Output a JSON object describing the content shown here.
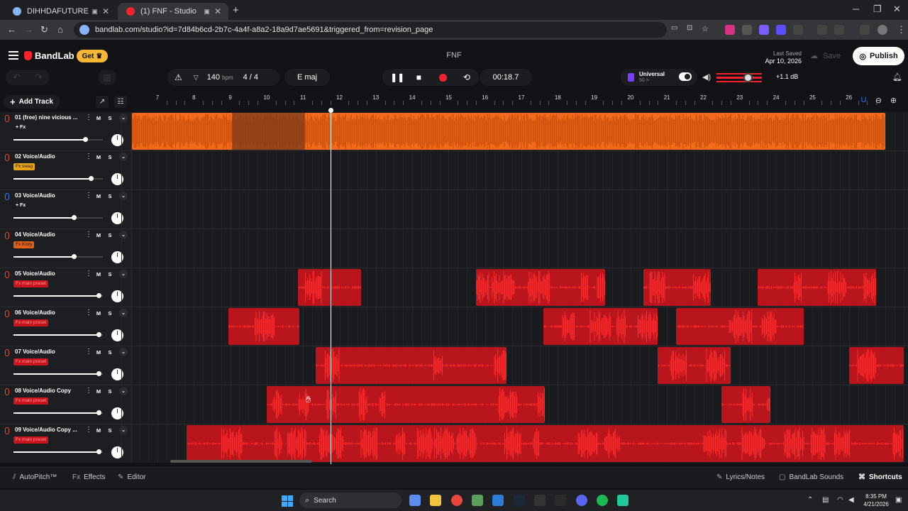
{
  "browser": {
    "tabs": [
      {
        "label": "DIHHDAFUTURE",
        "active": false
      },
      {
        "label": "(1) FNF - Studio",
        "active": true
      }
    ],
    "url": "bandlab.com/studio?id=7d84b6cd-2b7c-4a4f-a8a2-18a9d7ae5691&triggered_from=revision_page"
  },
  "app": {
    "logo": "BandLab",
    "get_label": "Get",
    "project_title": "FNF",
    "last_saved_label": "Last Saved",
    "last_saved_date": "Apr 10, 2026",
    "save_label": "Save",
    "publish_label": "Publish"
  },
  "toolbar": {
    "bpm": "140",
    "bpm_unit": "bpm",
    "time_signature": "4 / 4",
    "key": "E maj",
    "time": "00:18.7",
    "universal_title": "Universal",
    "universal_sub": "50 >",
    "volume_db": "+1.1 dB",
    "volume_level": 0.68
  },
  "sidebar": {
    "add_track_label": "Add Track"
  },
  "ruler": {
    "bars": [
      "7",
      "8",
      "9",
      "10",
      "11",
      "12",
      "13",
      "14",
      "15",
      "16",
      "17",
      "18",
      "19",
      "20",
      "21",
      "22",
      "23",
      "24",
      "25",
      "26"
    ]
  },
  "playhead_bar": 11.75,
  "tracks": [
    {
      "name": "01  (free) nine vicious ...",
      "fx": "+ Fx",
      "fx_style": "plain",
      "volume": 0.78,
      "color": "orange",
      "clips": [
        {
          "start": 6.25,
          "end": 27.0,
          "color": "orange",
          "muted_segment": [
            9.05,
            11.05
          ]
        }
      ]
    },
    {
      "name": "02  Voice/Audio",
      "fx": "Fx swag",
      "fx_style": "yellow",
      "volume": 0.84,
      "color": "red",
      "clips": []
    },
    {
      "name": "03  Voice/Audio",
      "fx": "+ Fx",
      "fx_style": "plain",
      "volume": 0.65,
      "color": "blue",
      "clips": []
    },
    {
      "name": "04  Voice/Audio",
      "fx": "Fx Kozy",
      "fx_style": "orange",
      "volume": 0.65,
      "color": "red",
      "clips": []
    },
    {
      "name": "05  Voice/Audio",
      "fx": "Fx main preset",
      "fx_style": "red",
      "volume": 0.92,
      "color": "red",
      "clips": [
        {
          "start": 10.85,
          "end": 12.6
        },
        {
          "start": 15.75,
          "end": 19.3
        },
        {
          "start": 20.35,
          "end": 22.2
        },
        {
          "start": 23.5,
          "end": 26.75
        }
      ]
    },
    {
      "name": "06  Voice/Audio",
      "fx": "Fx main preset",
      "fx_style": "red",
      "volume": 0.92,
      "color": "red",
      "clips": [
        {
          "start": 8.95,
          "end": 10.9
        },
        {
          "start": 17.6,
          "end": 20.75
        },
        {
          "start": 21.25,
          "end": 24.75
        }
      ]
    },
    {
      "name": "07  Voice/Audio",
      "fx": "Fx main preset",
      "fx_style": "red",
      "volume": 0.92,
      "color": "red",
      "clips": [
        {
          "start": 11.35,
          "end": 16.6
        },
        {
          "start": 20.75,
          "end": 22.75
        },
        {
          "start": 26.0,
          "end": 27.5
        }
      ]
    },
    {
      "name": "08  Voice/Audio Copy",
      "fx": "Fx main preset",
      "fx_style": "red",
      "volume": 0.92,
      "color": "red",
      "clips": [
        {
          "start": 10.0,
          "end": 17.65
        },
        {
          "start": 22.5,
          "end": 23.85
        }
      ]
    },
    {
      "name": "09  Voice/Audio Copy ...",
      "fx": "Fx main preset",
      "fx_style": "red",
      "volume": 0.92,
      "color": "red",
      "clips": [
        {
          "start": 7.8,
          "end": 27.5
        }
      ]
    }
  ],
  "bottom": {
    "autopitch": "AutoPitch™",
    "effects": "Effects",
    "editor": "Editor",
    "lyrics": "Lyrics/Notes",
    "sounds": "BandLab Sounds",
    "shortcuts": "Shortcuts"
  },
  "taskbar": {
    "search": "Search",
    "time": "8:35 PM",
    "date": "4/21/2026"
  },
  "colors": {
    "orange_clip": "#f26a1b",
    "red_clip": "#b8161c",
    "red_wave": "#ff2a2a",
    "accent": "#f5222d"
  }
}
